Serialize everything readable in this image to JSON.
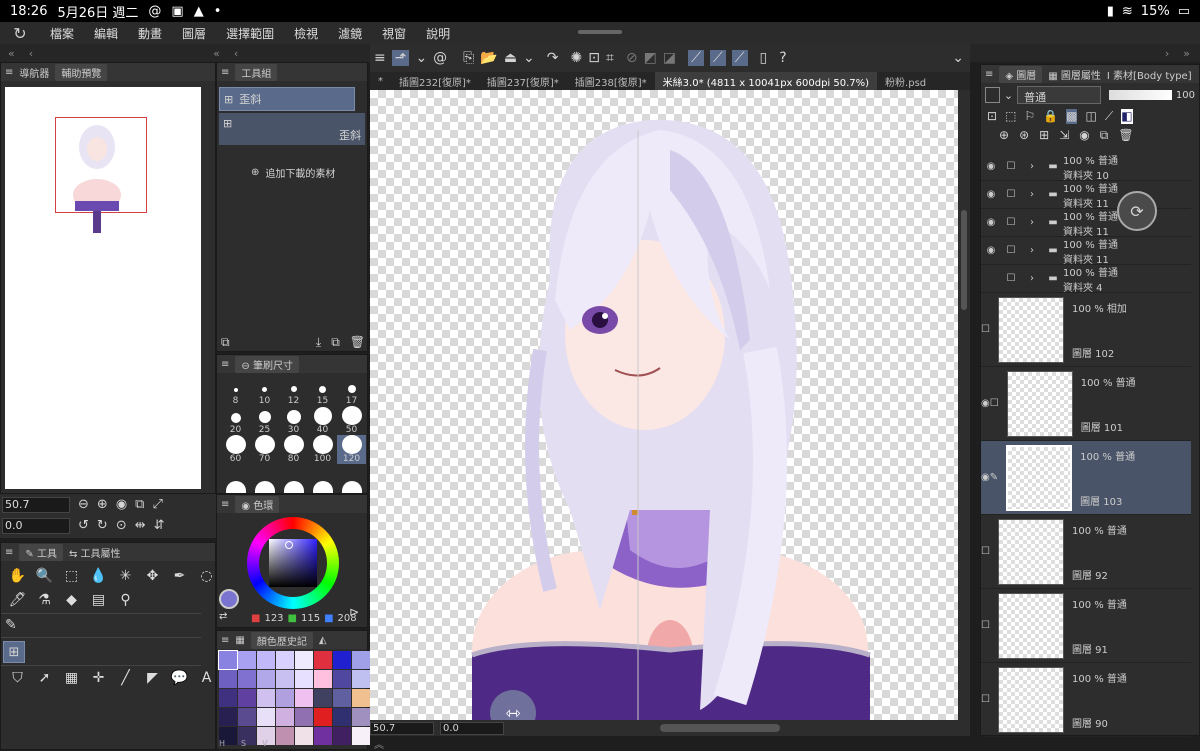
{
  "status": {
    "time": "18:26",
    "date": "5月26日 週二",
    "battery": "15%"
  },
  "menu": [
    "檔案",
    "編輯",
    "動畫",
    "圖層",
    "選擇範圍",
    "檢視",
    "濾鏡",
    "視窗",
    "說明"
  ],
  "navigator": {
    "tab1": "導航器",
    "tab2": "輔助預覽"
  },
  "toolgroup": {
    "title": "工具組",
    "item1": "歪斜",
    "item2": "歪斜",
    "add": "追加下載的素材"
  },
  "view_controls": {
    "zoom": "50.7",
    "angle": "0.0"
  },
  "tools": {
    "tab1": "工具",
    "tab2": "工具屬性"
  },
  "brush": {
    "title": "筆刷尺寸",
    "sizes": [
      "8",
      "10",
      "12",
      "15",
      "17",
      "20",
      "25",
      "30",
      "40",
      "50",
      "60",
      "70",
      "80",
      "100",
      "120",
      "",
      "",
      "",
      "",
      ""
    ]
  },
  "color": {
    "title": "色環",
    "r": "123",
    "g": "115",
    "b": "208",
    "main": "#7b73d0"
  },
  "history": {
    "title": "顏色歷史記",
    "labels": [
      "H",
      "S",
      "V"
    ]
  },
  "swatches": [
    "#8a82e0",
    "#a8a0f0",
    "#c0b8f8",
    "#d8d0ff",
    "#f0eaff",
    "#e03040",
    "#2020d0",
    "#a0a0e8",
    "#6e60c0",
    "#8070d0",
    "#b0a8e8",
    "#c8c0f0",
    "#e8e0ff",
    "#ffc0e0",
    "#5048a0",
    "#c0c0f0",
    "#403080",
    "#6040a0",
    "#d0c0f0",
    "#b0a0e0",
    "#f0c0f0",
    "#404060",
    "#6060a0",
    "#f0c090",
    "#282050",
    "#5a4a90",
    "#e8e0f8",
    "#d0b0e0",
    "#9070b0",
    "#e02020",
    "#303070",
    "#a090c0",
    "#1a1838",
    "#3a3060",
    "#e0d0e8",
    "#c090b0",
    "#f0e0e8",
    "#7030a0",
    "#402060",
    "#f8f0f8"
  ],
  "doc_tabs": [
    "*",
    "插圖232[復原]*",
    "插圖237[復原]*",
    "插圖238[復原]*",
    "米絲3.0* (4811 x 10041px 600dpi 50.7%)",
    "粉粉.psd"
  ],
  "canvas_footer": {
    "zoom": "50.7",
    "angle": "0.0"
  },
  "layer_panel": {
    "tab1": "圖層",
    "tab2": "圖層屬性",
    "tab3": "素材[Body type]",
    "blend": "普通",
    "opacity": "100"
  },
  "folders": [
    {
      "pct": "100 % 普通",
      "name": "資料夾 10"
    },
    {
      "pct": "100 % 普通",
      "name": "資料夾 11"
    },
    {
      "pct": "100 % 普通",
      "name": "資料夾 11"
    },
    {
      "pct": "100 % 普通",
      "name": "資料夾 11"
    },
    {
      "pct": "100 % 普通",
      "name": "資料夾 4"
    }
  ],
  "layers": [
    {
      "pct": "100 % 相加",
      "name": "圖層 102"
    },
    {
      "pct": "100 % 普通",
      "name": "圖層 101"
    },
    {
      "pct": "100 % 普通",
      "name": "圖層 103"
    },
    {
      "pct": "100 % 普通",
      "name": "圖層 92"
    },
    {
      "pct": "100 % 普通",
      "name": "圖層 91"
    },
    {
      "pct": "100 % 普通",
      "name": "圖層 90"
    }
  ]
}
